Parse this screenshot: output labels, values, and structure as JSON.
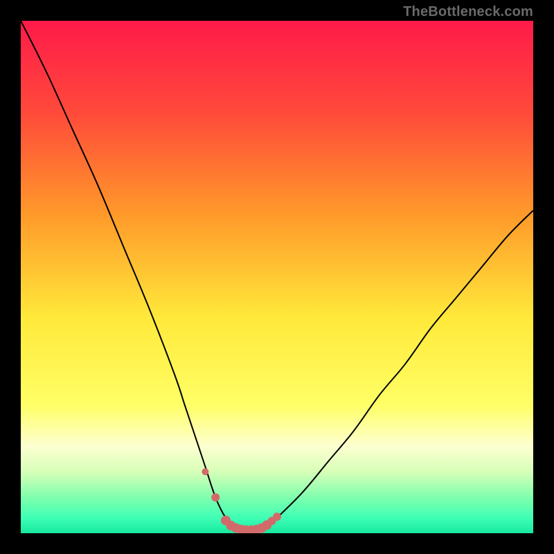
{
  "watermark": "TheBottleneck.com",
  "colors": {
    "black": "#000000",
    "curve": "#000000",
    "marker_fill": "#d26a6a",
    "marker_stroke": "#c75a5a",
    "gradient_stops": [
      {
        "offset": 0,
        "color": "#ff1a4a"
      },
      {
        "offset": 18,
        "color": "#ff4a3a"
      },
      {
        "offset": 38,
        "color": "#ff9a2a"
      },
      {
        "offset": 58,
        "color": "#ffe93a"
      },
      {
        "offset": 75,
        "color": "#ffff66"
      },
      {
        "offset": 83,
        "color": "#fdffd0"
      },
      {
        "offset": 88,
        "color": "#d7ffb8"
      },
      {
        "offset": 93,
        "color": "#7fffad"
      },
      {
        "offset": 97,
        "color": "#3fffb5"
      },
      {
        "offset": 100,
        "color": "#18e8a0"
      }
    ]
  },
  "chart_data": {
    "type": "line",
    "title": "",
    "xlabel": "",
    "ylabel": "",
    "xlim": [
      0,
      100
    ],
    "ylim": [
      0,
      100
    ],
    "legend": false,
    "grid": false,
    "series": [
      {
        "name": "bottleneck-curve",
        "x": [
          0,
          5,
          10,
          15,
          20,
          25,
          30,
          32,
          34,
          36,
          38,
          40,
          42,
          44,
          46,
          48,
          50,
          55,
          60,
          65,
          70,
          75,
          80,
          85,
          90,
          95,
          100
        ],
        "y": [
          100,
          90,
          79,
          68,
          56,
          44,
          31,
          25,
          19,
          13,
          7,
          3,
          1,
          0,
          0,
          1,
          3,
          8,
          14,
          20,
          27,
          33,
          40,
          46,
          52,
          58,
          63
        ]
      }
    ],
    "markers": {
      "name": "highlight-points",
      "x": [
        36,
        38,
        40,
        41,
        42,
        43,
        44,
        45,
        46,
        47,
        48,
        49,
        50
      ],
      "y": [
        12,
        7,
        2.5,
        1.5,
        1,
        0.7,
        0.6,
        0.6,
        0.7,
        1,
        1.6,
        2.4,
        3.2
      ],
      "r": [
        5,
        6,
        7,
        7,
        7,
        7,
        7,
        7,
        7,
        7,
        7,
        6,
        6
      ]
    }
  }
}
